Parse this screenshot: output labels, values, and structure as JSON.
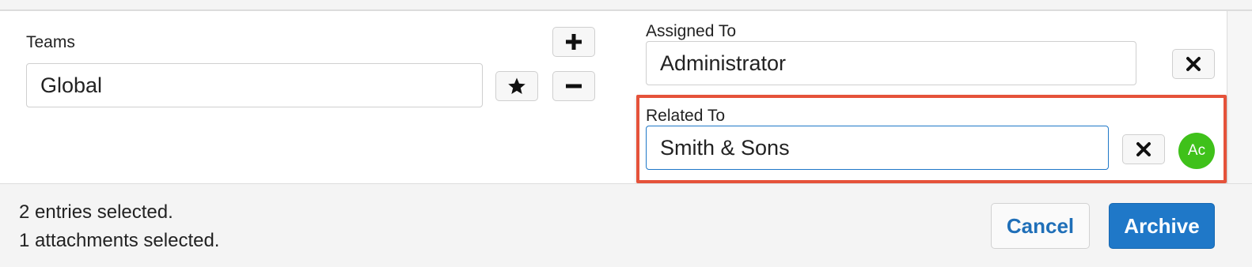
{
  "teams": {
    "label": "Teams",
    "value": "Global",
    "add_icon": "plus-icon",
    "remove_icon": "minus-icon",
    "primary_icon": "star-icon"
  },
  "assigned_to": {
    "label": "Assigned To",
    "value": "Administrator",
    "clear_icon": "x-icon"
  },
  "related_to": {
    "label": "Related To",
    "value": "Smith & Sons",
    "clear_icon": "x-icon",
    "module_badge": "Ac",
    "badge_color": "#3fc11a",
    "highlight_color": "#e5523a"
  },
  "footer": {
    "entries_selected": "2 entries selected.",
    "attachments_selected": "1 attachments selected.",
    "cancel_label": "Cancel",
    "archive_label": "Archive"
  },
  "colors": {
    "primary": "#1f78c8",
    "link": "#1f6fb8"
  }
}
